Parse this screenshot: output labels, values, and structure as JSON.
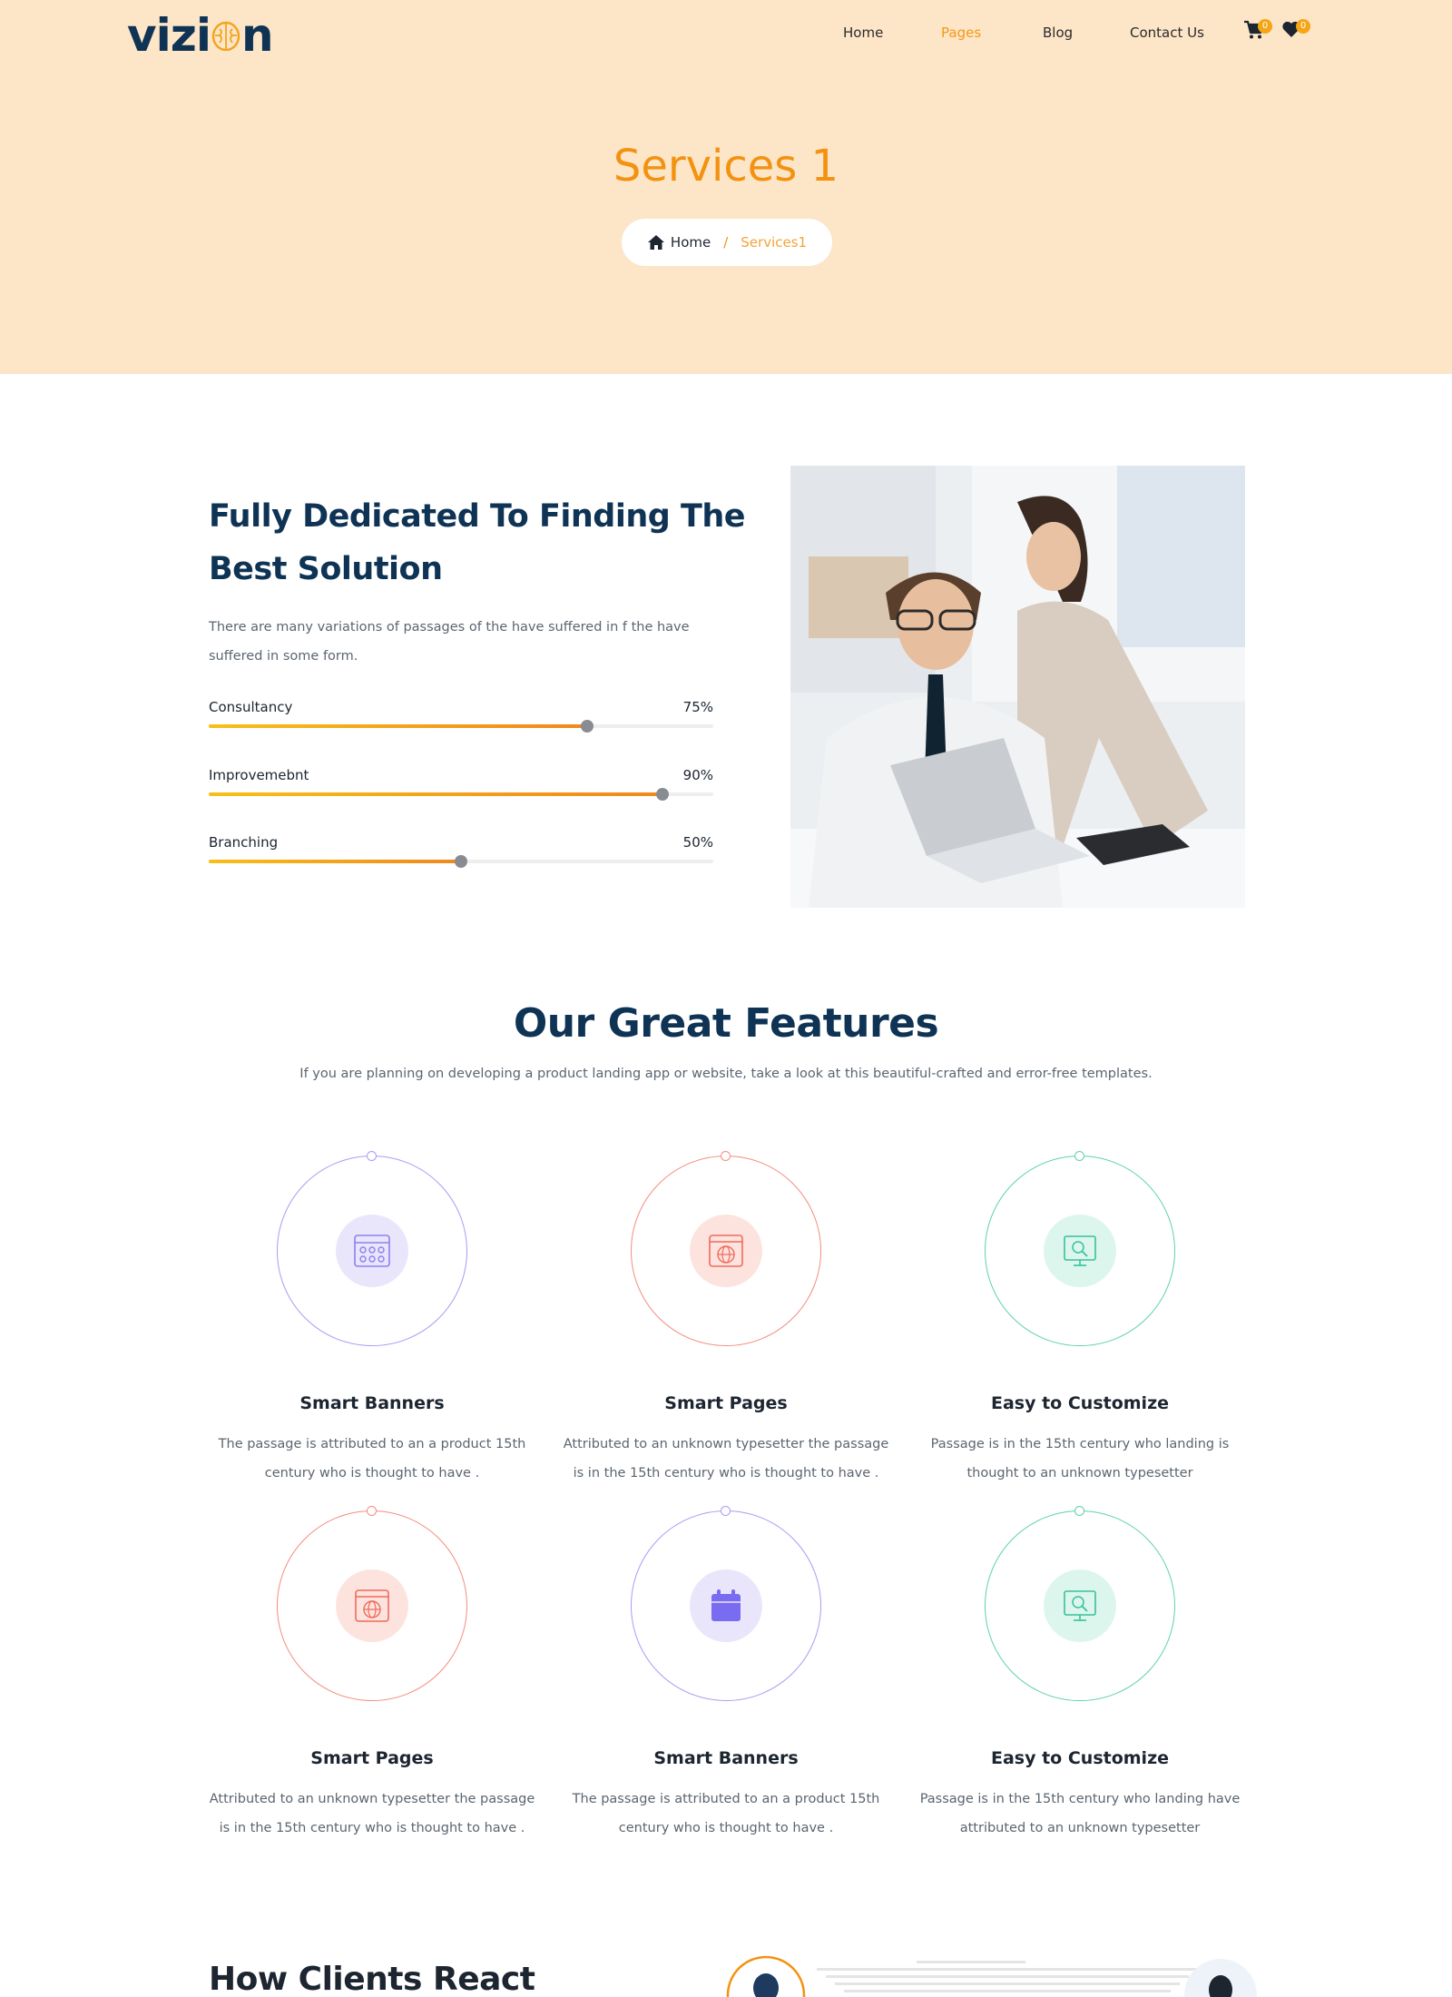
{
  "brand": {
    "logo_left": "vizi",
    "logo_right": "n"
  },
  "nav": {
    "items": [
      "Home",
      "Pages",
      "Blog",
      "Contact Us"
    ],
    "active": "Pages",
    "cart_count": "0",
    "wishlist_count": "0"
  },
  "hero": {
    "title": "Services 1",
    "breadcrumb_home": "Home",
    "breadcrumb_sep": "/",
    "breadcrumb_current": "Services1"
  },
  "about": {
    "title": "Fully Dedicated To Finding The Best Solution",
    "text": "There are many variations of passages of the have suffered in f the have suffered in some form.",
    "skills": [
      {
        "name": "Consultancy",
        "percent_label": "75%",
        "value": 75
      },
      {
        "name": "Improvemebnt",
        "percent_label": "90%",
        "value": 90
      },
      {
        "name": "Branching",
        "percent_label": "50%",
        "value": 50
      }
    ]
  },
  "features": {
    "title": "Our Great Features",
    "subtitle": "If you are planning on developing a product landing app or website, take a look at this beautiful-crafted and error-free templates.",
    "cards": [
      {
        "title": "Smart Banners",
        "desc": "The passage is attributed to an a product 15th century who is thought to have .",
        "icon": "calendar-grid-icon",
        "color": "#a79cf5",
        "bg": "#e9e6fc"
      },
      {
        "title": "Smart Pages",
        "desc": "Attributed to an unknown typesetter the passage is in the 15th century who is thought to have .",
        "icon": "globe-window-icon",
        "color": "#f48c7f",
        "bg": "#fde3de"
      },
      {
        "title": "Easy to Customize",
        "desc": "Passage is in the 15th century who landing is thought to an unknown typesetter",
        "icon": "monitor-search-icon",
        "color": "#5ed1b0",
        "bg": "#dcf6ee"
      },
      {
        "title": "Smart Pages",
        "desc": "Attributed to an unknown typesetter the passage is in the 15th century who is thought to have .",
        "icon": "globe-window-icon",
        "color": "#f48c7f",
        "bg": "#fde3de"
      },
      {
        "title": "Smart Banners",
        "desc": "The passage is attributed to an a product 15th century who is thought to have .",
        "icon": "calendar-solid-icon",
        "color": "#a79cf5",
        "bg": "#e9e6fc"
      },
      {
        "title": "Easy to Customize",
        "desc": "Passage is in the 15th century who landing have attributed to an unknown typesetter",
        "icon": "monitor-search-icon",
        "color": "#5ed1b0",
        "bg": "#dcf6ee"
      }
    ]
  },
  "clients": {
    "title": "How Clients React"
  }
}
